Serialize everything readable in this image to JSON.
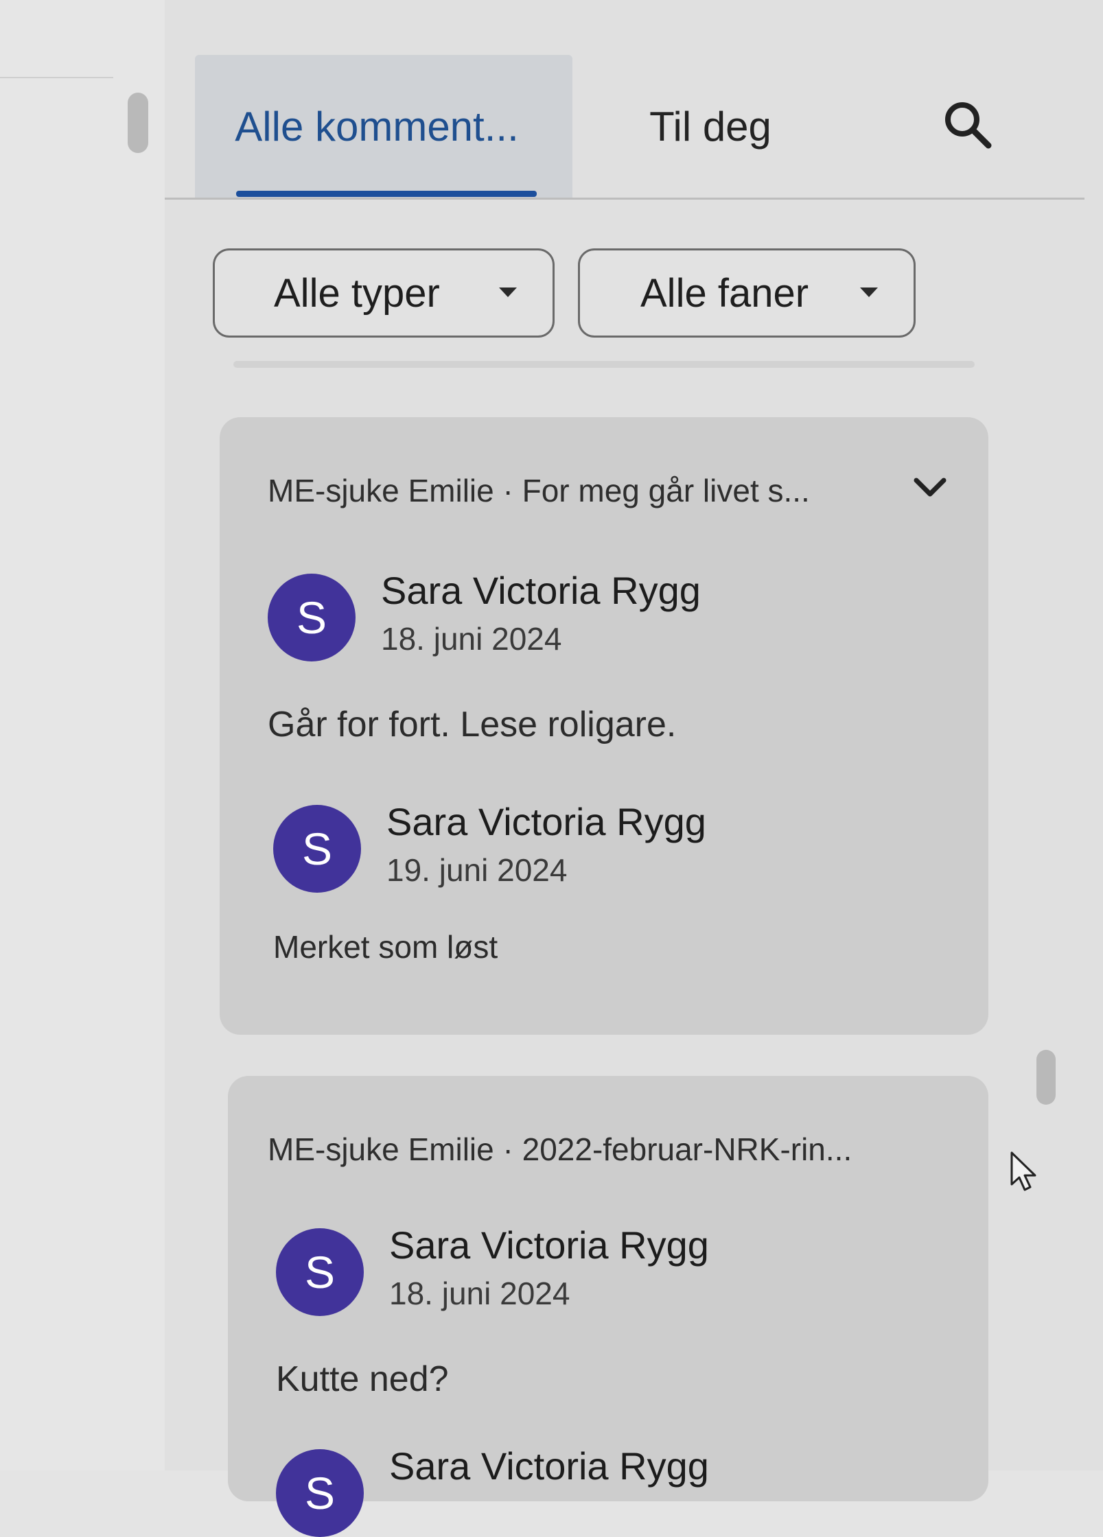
{
  "tabs": {
    "all_label": "Alle komment...",
    "you_label": "Til deg"
  },
  "filters": {
    "types_label": "Alle typer",
    "tabs_label": "Alle faner"
  },
  "threads": [
    {
      "header": "ME-sjuke Emilie · For meg går livet s...",
      "comments": [
        {
          "avatar_letter": "S",
          "author": "Sara Victoria Rygg",
          "date": "18. juni 2024",
          "text": "Går for fort. Lese roligare."
        },
        {
          "avatar_letter": "S",
          "author": "Sara Victoria Rygg",
          "date": "19. juni 2024",
          "text": "Merket som løst"
        }
      ]
    },
    {
      "header": "ME-sjuke Emilie · 2022-februar-NRK-rin...",
      "comments": [
        {
          "avatar_letter": "S",
          "author": "Sara Victoria Rygg",
          "date": "18. juni 2024",
          "text": "Kutte ned?"
        },
        {
          "avatar_letter": "S",
          "author": "Sara Victoria Rygg"
        }
      ]
    }
  ],
  "colors": {
    "accent": "#1c4f9c",
    "avatar": "#41339a"
  },
  "icons": {
    "search": "search-icon",
    "chevron": "chevron-down-icon",
    "caret": "caret-down-icon",
    "cursor": "mouse-pointer-icon"
  }
}
